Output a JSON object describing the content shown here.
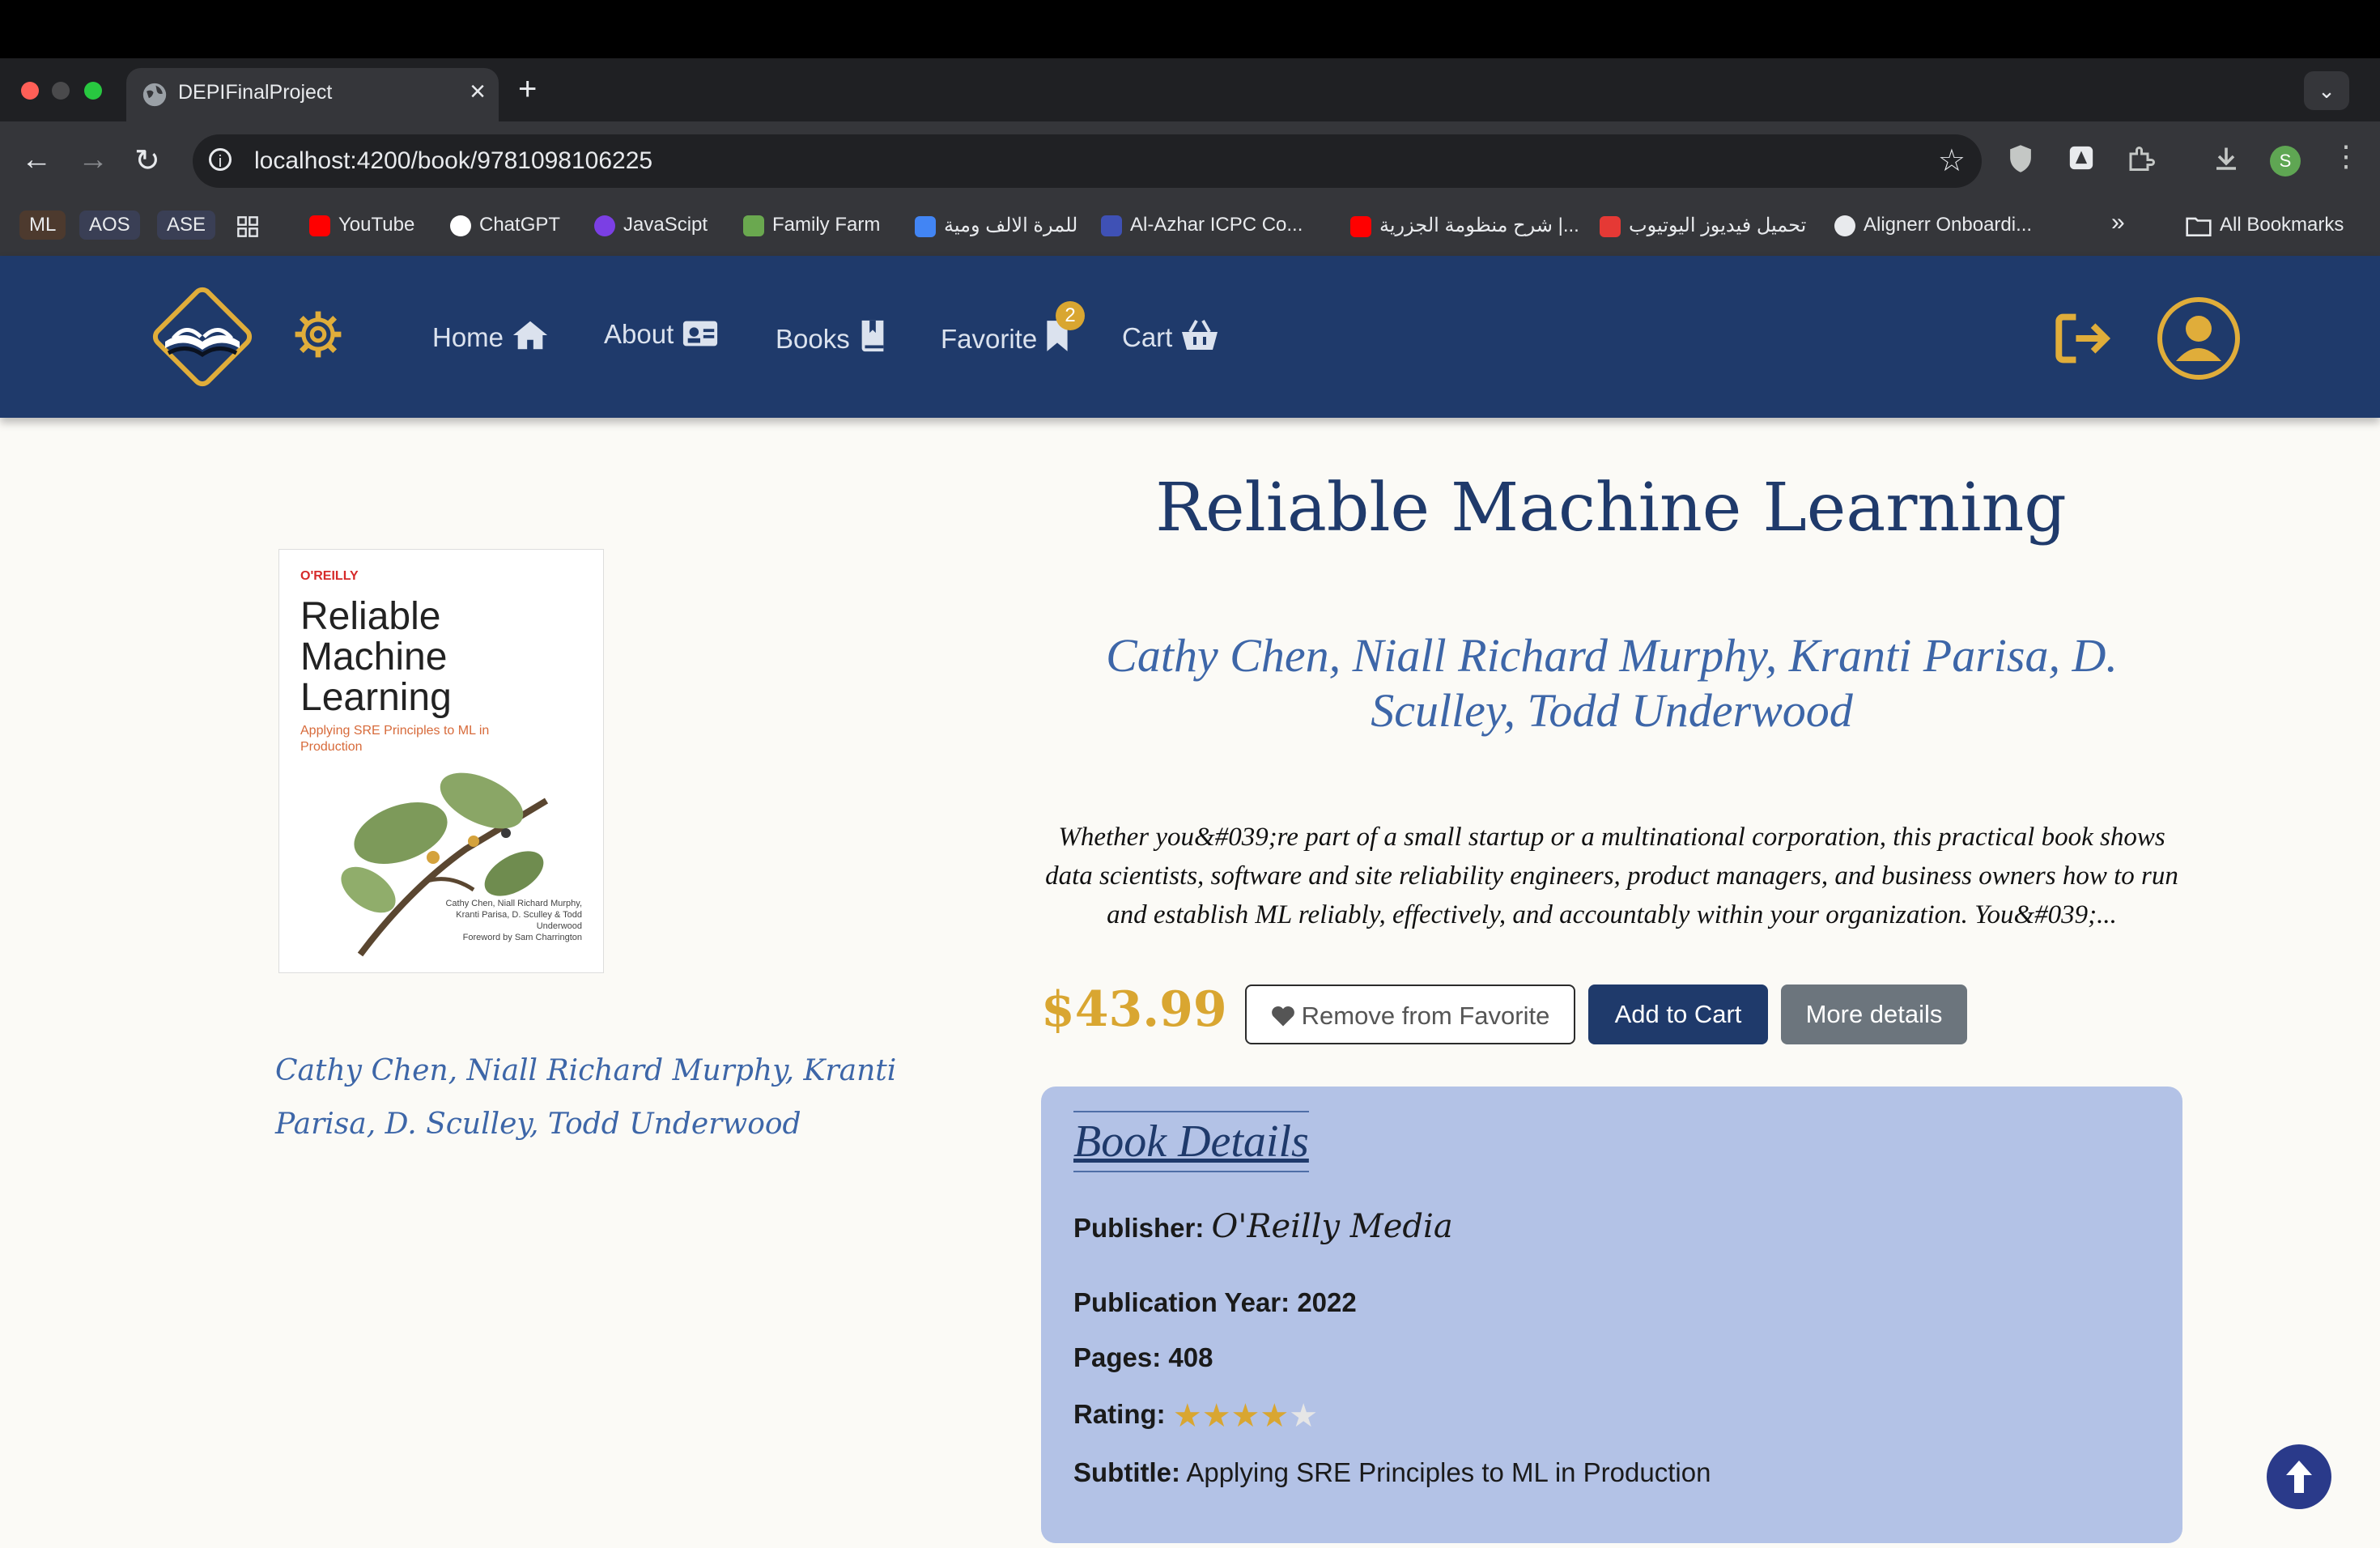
{
  "browser": {
    "tab_title": "DEPIFinalProject",
    "tab_close": "×",
    "new_tab": "+",
    "tab_menu": "⌄",
    "url": "localhost:4200/book/9781098106225",
    "profile_initial": "S",
    "bookmarks": [
      {
        "label": "YouTube",
        "color": "#ff0000"
      },
      {
        "label": "ChatGPT",
        "color": "#ffffff"
      },
      {
        "label": "JavaScipt",
        "color": "#7b3fe4"
      },
      {
        "label": "Family Farm",
        "color": "#6aa84f"
      },
      {
        "label": "للمرة الالف ومية",
        "color": "#4285f4"
      },
      {
        "label": "Al-Azhar ICPC Co...",
        "color": "#3f51b5"
      },
      {
        "label": "شرح منظومة الجزرية |...",
        "color": "#ff0000"
      },
      {
        "label": "تحميل فيديوز اليوتيوب",
        "color": "#e53935"
      },
      {
        "label": "Alignerr Onboardi...",
        "color": "#e8eaed"
      }
    ],
    "badges": [
      "ML",
      "AOS",
      "ASE"
    ],
    "overflow": "»",
    "all_bookmarks": "All Bookmarks"
  },
  "nav": {
    "home": "Home",
    "about": "About",
    "books": "Books",
    "favorite": "Favorite",
    "favorite_count": "2",
    "cart": "Cart"
  },
  "book": {
    "cover": {
      "publisher": "O'REILLY",
      "title": "Reliable Machine Learning",
      "subtitle": "Applying SRE Principles to ML in Production",
      "authors": "Cathy Chen, Niall Richard Murphy, Kranti Parisa, D. Sculley & Todd Underwood",
      "foreword": "Foreword by Sam Charrington"
    },
    "title": "Reliable Machine Learning",
    "authors": "Cathy Chen, Niall Richard Murphy, Kranti Parisa, D. Sculley, Todd Underwood",
    "description": "Whether you&#039;re part of a small startup or a multinational corporation, this practical book shows data scientists, software and site reliability engineers, product managers, and business owners how to run and establish ML reliably, effectively, and accountably within your organization. You&#039;...",
    "price": "$43.99",
    "rating": 4,
    "rating_max": 5
  },
  "actions": {
    "remove_favorite": "Remove from Favorite",
    "add_to_cart": "Add to Cart",
    "more_details": "More details"
  },
  "details": {
    "heading": "Book Details",
    "publisher_label": "Publisher:",
    "publisher": "O'Reilly Media",
    "year_label": "Publication Year:",
    "year": "2022",
    "pages_label": "Pages:",
    "pages": "408",
    "rating_label": "Rating:",
    "subtitle_label": "Subtitle:",
    "subtitle": "Applying SRE Principles to ML in Production"
  },
  "colors": {
    "navbar": "#1f3a6b",
    "accent_gold": "#d9a631",
    "details_bg": "#b3c2e6",
    "link_blue": "#3d66a8"
  }
}
